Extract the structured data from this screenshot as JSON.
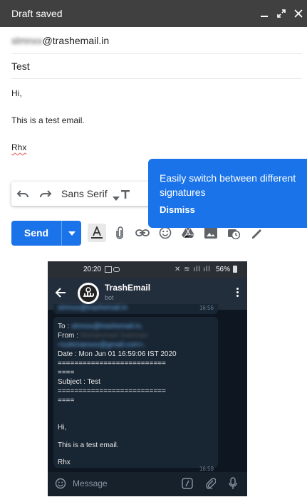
{
  "header": {
    "title": "Draft saved"
  },
  "recipient": {
    "prefix": "slmnxx",
    "domain": "@trashemail.in"
  },
  "subject": "Test",
  "body": {
    "greeting": "Hi,",
    "line": "This is a test email.",
    "signature": "Rhx"
  },
  "format_bar": {
    "font": "Sans Serif"
  },
  "send": {
    "label": "Send"
  },
  "tooltip": {
    "message": "Easily switch between different signatures",
    "dismiss": "Dismiss"
  },
  "phone": {
    "time": "20:20",
    "battery": "56%",
    "app_title": "TrashEmail",
    "app_sub": "bot",
    "prev_time": "16:56",
    "prev_blur": "slmnxx@trashemail.in",
    "to_label": "To : ",
    "to_value": "slmnxx@trashemail.in,",
    "from_label": "From : ",
    "from_name": "Mohammad Suleman",
    "from_email": "<sulemanxxx@gmail.com>,",
    "date": "Date : Mon Jun 01 16:59:06 IST 2020",
    "sep1": "==========================",
    "sep1b": "====",
    "subject": "Subject : Test",
    "sep2": "==========================",
    "sep2b": "====",
    "greeting": "Hi,",
    "line": "This is a test email.",
    "signature": "Rhx",
    "msg_time": "16:59",
    "input_placeholder": "Message"
  },
  "colors": {
    "accent": "#1a73e8",
    "header_bg": "#404040"
  }
}
